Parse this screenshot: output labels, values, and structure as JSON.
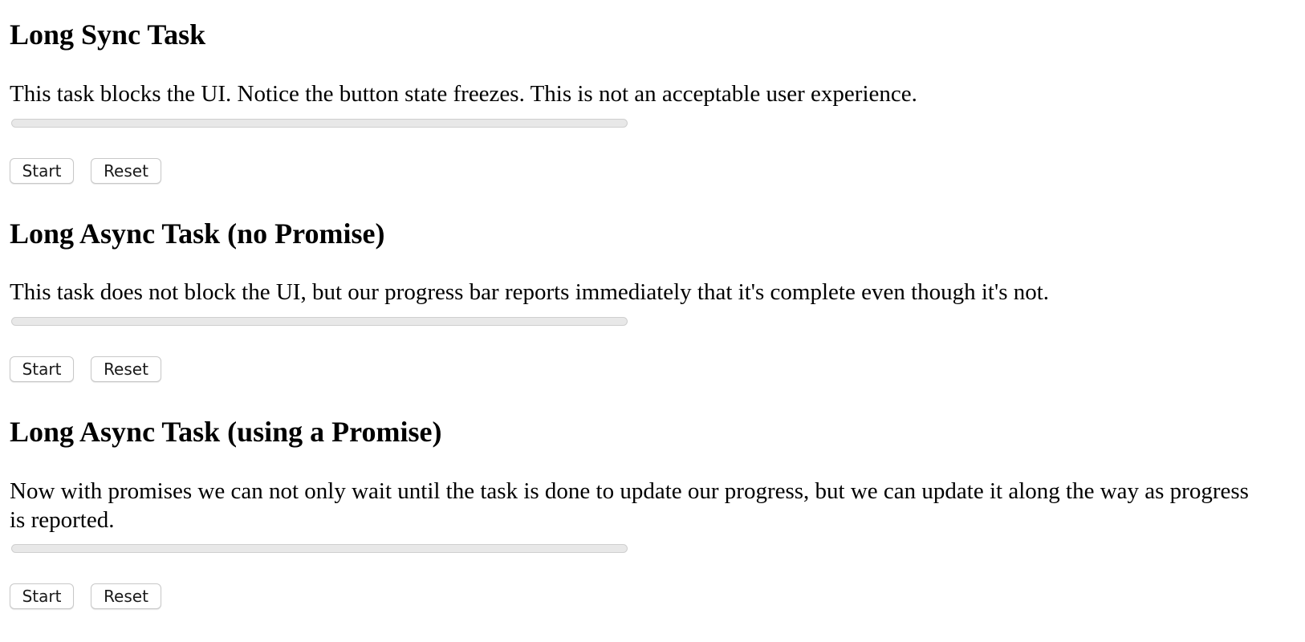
{
  "sections": [
    {
      "title": "Long Sync Task",
      "description": "This task blocks the UI. Notice the button state freezes. This is not an acceptable user experience.",
      "progress": 0,
      "start_label": "Start",
      "reset_label": "Reset"
    },
    {
      "title": "Long Async Task (no Promise)",
      "description": "This task does not block the UI, but our progress bar reports immediately that it's complete even though it's not.",
      "progress": 0,
      "start_label": "Start",
      "reset_label": "Reset"
    },
    {
      "title": "Long Async Task (using a Promise)",
      "description": "Now with promises we can not only wait until the task is done to update our progress, but we can update it along the way as progress is reported.",
      "progress": 0,
      "start_label": "Start",
      "reset_label": "Reset"
    }
  ]
}
